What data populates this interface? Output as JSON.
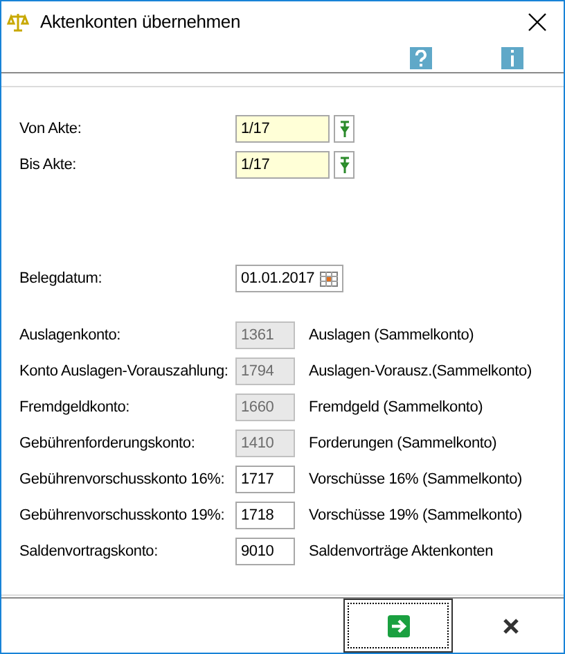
{
  "window": {
    "title": "Aktenkonten übernehmen"
  },
  "akte": [
    {
      "label": "Von Akte:",
      "value": "1/17"
    },
    {
      "label": "Bis Akte:",
      "value": "1/17"
    }
  ],
  "belegdatum": {
    "label": "Belegdatum:",
    "value": "01.01.2017"
  },
  "accounts": [
    {
      "label": "Auslagenkonto:",
      "value": "1361",
      "disabled": true,
      "description": "Auslagen (Sammelkonto)"
    },
    {
      "label": "Konto Auslagen-Vorauszahlung:",
      "value": "1794",
      "disabled": true,
      "description": "Auslagen-Vorausz.(Sammelkonto)"
    },
    {
      "label": "Fremdgeldkonto:",
      "value": "1660",
      "disabled": true,
      "description": "Fremdgeld (Sammelkonto)"
    },
    {
      "label": "Gebührenforderungskonto:",
      "value": "1410",
      "disabled": true,
      "description": "Forderungen (Sammelkonto)"
    },
    {
      "label": "Gebührenvorschusskonto 16%:",
      "value": "1717",
      "disabled": false,
      "description": "Vorschüsse 16% (Sammelkonto)"
    },
    {
      "label": "Gebührenvorschusskonto 19%:",
      "value": "1718",
      "disabled": false,
      "description": "Vorschüsse 19% (Sammelkonto)"
    },
    {
      "label": "Saldenvortragskonto:",
      "value": "9010",
      "disabled": false,
      "description": "Saldenvorträge Aktenkonten"
    }
  ]
}
